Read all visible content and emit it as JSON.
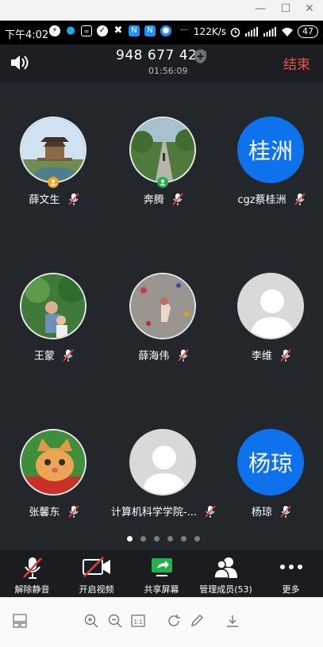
{
  "status_bar": {
    "time": "下午4:02",
    "network_speed": "122K/s",
    "battery": "47"
  },
  "call": {
    "meeting_id": "948 677 429",
    "duration": "01:56:09",
    "end_label": "结束"
  },
  "participants": [
    {
      "name": "薛文生",
      "avatar_type": "photo",
      "avatar_text": "",
      "badge_color": "#f5a623"
    },
    {
      "name": "奔腾",
      "avatar_type": "photo",
      "avatar_text": "",
      "badge_color": "#23b14d"
    },
    {
      "name": "cgz蔡桂洲",
      "avatar_type": "text",
      "avatar_text": "桂洲",
      "badge_color": ""
    },
    {
      "name": "王蒙",
      "avatar_type": "photo",
      "avatar_text": "",
      "badge_color": ""
    },
    {
      "name": "薛海伟",
      "avatar_type": "photo",
      "avatar_text": "",
      "badge_color": ""
    },
    {
      "name": "李维",
      "avatar_type": "default",
      "avatar_text": "",
      "badge_color": ""
    },
    {
      "name": "张馨东",
      "avatar_type": "photo",
      "avatar_text": "",
      "badge_color": ""
    },
    {
      "name": "计算机科学学院-...",
      "avatar_type": "default",
      "avatar_text": "",
      "badge_color": ""
    },
    {
      "name": "杨琼",
      "avatar_type": "text",
      "avatar_text": "杨琼",
      "badge_color": ""
    }
  ],
  "pager": {
    "total": 6,
    "active": 0
  },
  "toolbar": {
    "unmute": "解除静音",
    "start_video": "开启视频",
    "share_screen": "共享屏幕",
    "manage_members": "管理成员(53)",
    "more": "更多"
  },
  "colors": {
    "accent_blue": "#0e72ed",
    "end_red": "#f0504b",
    "share_green": "#23b14d",
    "background": "#23262b"
  }
}
